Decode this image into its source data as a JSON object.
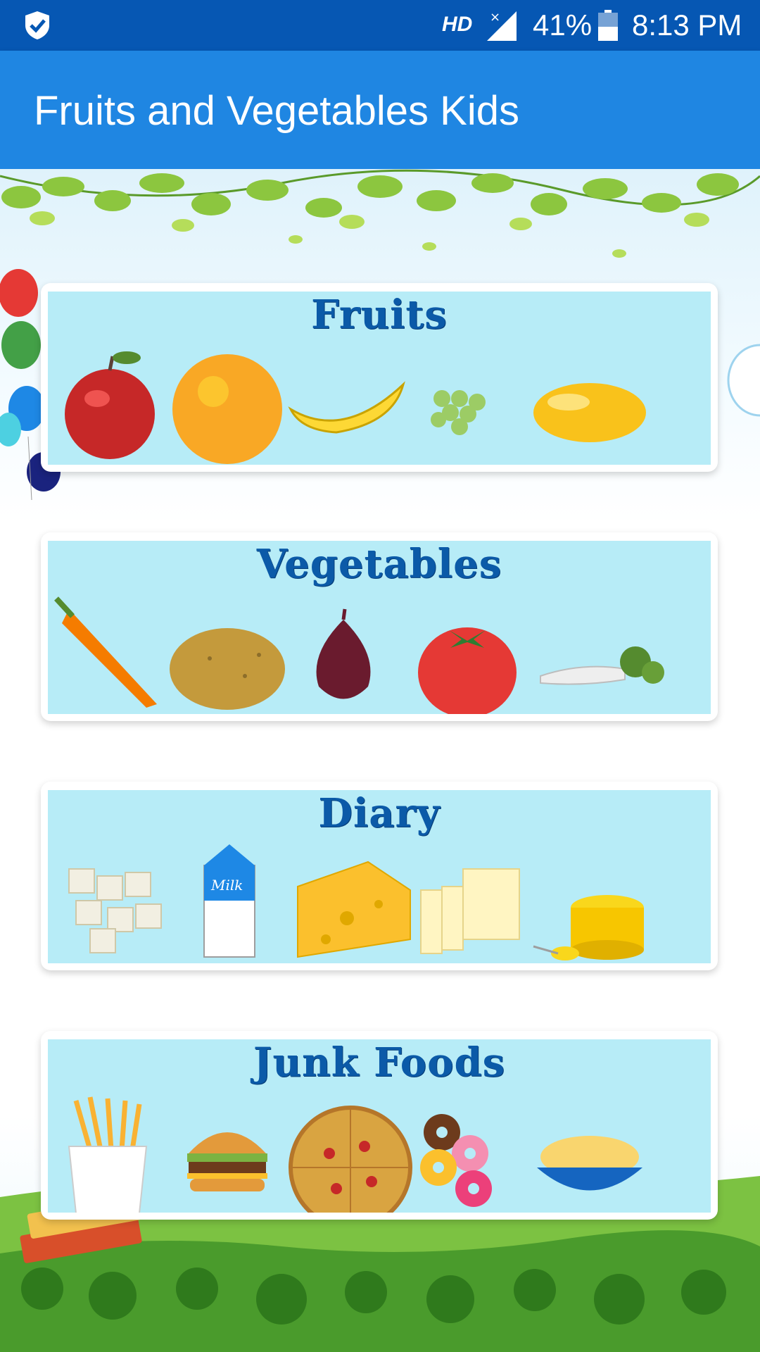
{
  "status_bar": {
    "network": "HD",
    "battery_percent": "41%",
    "time": "8:13 PM"
  },
  "app_bar": {
    "title": "Fruits and Vegetables Kids"
  },
  "categories": [
    {
      "title": "Fruits",
      "items": [
        "apple",
        "orange",
        "banana",
        "grapes",
        "mango"
      ]
    },
    {
      "title": "Vegetables",
      "items": [
        "carrot",
        "potato",
        "onion",
        "tomato",
        "radish"
      ]
    },
    {
      "title": "Diary",
      "items": [
        "paneer",
        "milk",
        "cheese",
        "butter",
        "ghee"
      ]
    },
    {
      "title": "Junk Foods",
      "items": [
        "french-fries",
        "burger",
        "pizza",
        "donuts",
        "chips"
      ]
    }
  ],
  "colors": {
    "status_bar": "#0657b3",
    "app_bar": "#1f86e2",
    "card_bg": "#b7ecf7",
    "title_color": "#0b5aa8"
  }
}
